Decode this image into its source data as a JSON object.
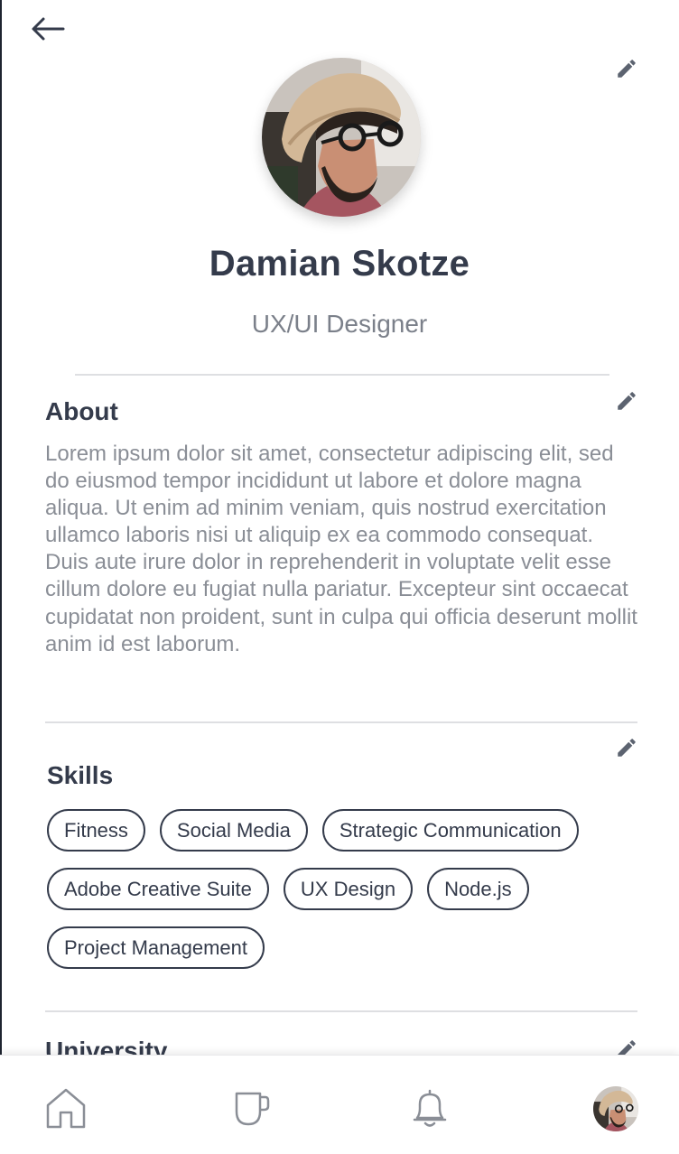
{
  "header": {
    "back_icon": "arrow-left-icon",
    "edit_icon": "pencil-icon"
  },
  "profile": {
    "name": "Damian Skotze",
    "role": "UX/UI Designer"
  },
  "about": {
    "title": "About",
    "text": "Lorem ipsum dolor sit amet, consectetur adipiscing elit, sed do eiusmod tempor incididunt ut labore et dolore magna aliqua. Ut enim ad minim veniam, quis nostrud exercitation ullamco laboris nisi ut aliquip ex ea commodo consequat. Duis aute irure dolor in reprehenderit in voluptate velit esse cillum dolore eu fugiat nulla pariatur. Excepteur sint occaecat cupidatat non proident, sunt in culpa qui officia deserunt mollit anim id est laborum."
  },
  "skills": {
    "title": "Skills",
    "items": [
      "Fitness",
      "Social Media",
      "Strategic Communication",
      "Adobe Creative Suite",
      "UX Design",
      "Node.js",
      "Project Management"
    ]
  },
  "next_section": {
    "title": "University"
  },
  "bottom_nav": {
    "items": [
      "home-icon",
      "coffee-cup-icon",
      "bell-icon",
      "profile-avatar"
    ]
  },
  "colors": {
    "text_dark": "#343b4b",
    "text_muted": "#8a8e96",
    "icon": "#5c6370",
    "divider": "#dedfe2"
  }
}
